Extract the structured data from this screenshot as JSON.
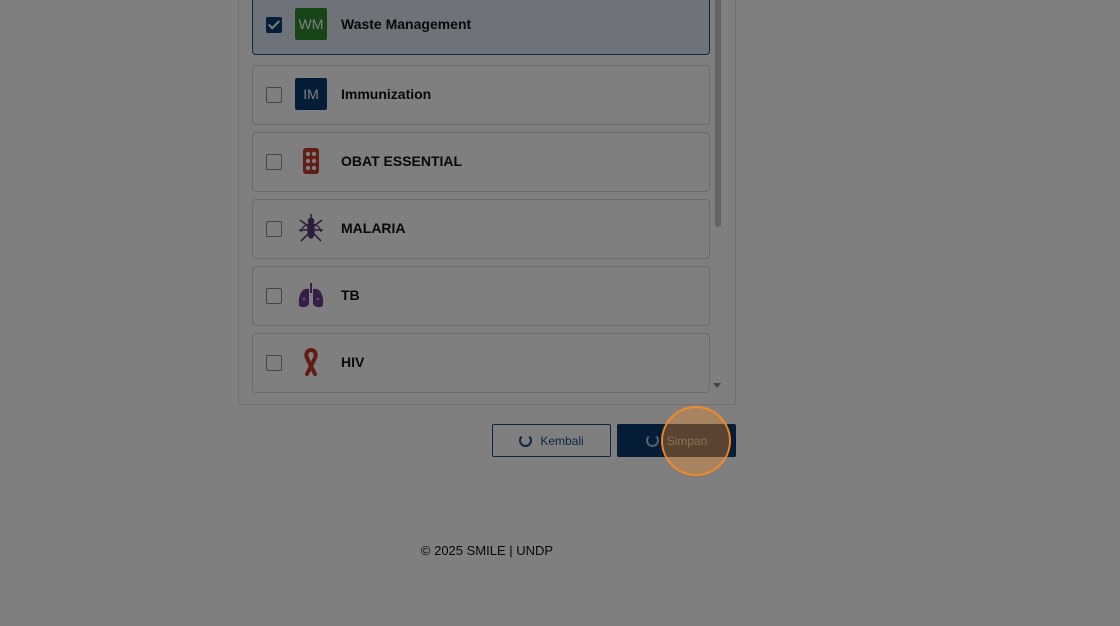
{
  "categories": [
    {
      "abbr": "WM",
      "label": "Waste Management",
      "checked": true,
      "icon": "wm-badge-icon",
      "color": "#2e8b2e"
    },
    {
      "abbr": "IM",
      "label": "Immunization",
      "checked": false,
      "icon": "im-badge-icon",
      "color": "#0b3a6e"
    },
    {
      "abbr": "",
      "label": "OBAT ESSENTIAL",
      "checked": false,
      "icon": "pills-icon",
      "color": "#c0392b"
    },
    {
      "abbr": "",
      "label": "MALARIA",
      "checked": false,
      "icon": "mosquito-icon",
      "color": "#5b3d78"
    },
    {
      "abbr": "",
      "label": "TB",
      "checked": false,
      "icon": "lungs-icon",
      "color": "#6b3f8f"
    },
    {
      "abbr": "",
      "label": "HIV",
      "checked": false,
      "icon": "ribbon-icon",
      "color": "#c0392b"
    }
  ],
  "buttons": {
    "back_label": "Kembali",
    "save_label": "Simpan"
  },
  "footer": {
    "text": "© 2025 SMILE | UNDP"
  }
}
